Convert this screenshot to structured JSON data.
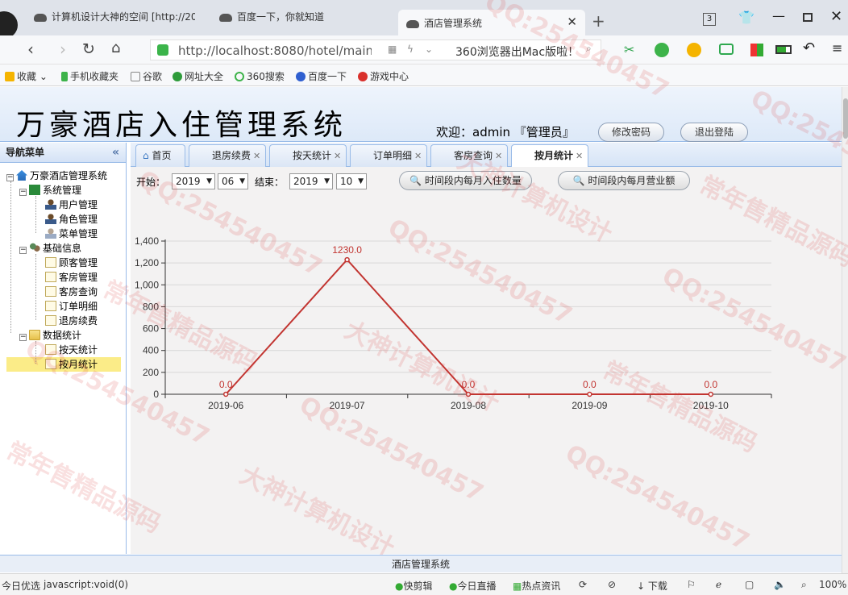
{
  "browser": {
    "tabs": [
      {
        "title": "计算机设计大神的空间 [http://20"
      },
      {
        "title": "百度一下，你就知道"
      },
      {
        "title": "酒店管理系统"
      }
    ],
    "tab_count": "3",
    "url": "http://localhost:8080/hotel/main.htm",
    "search_text": "360浏览器出Mac版啦！",
    "bookmarks": [
      "收藏",
      "手机收藏夹",
      "谷歌",
      "网址大全",
      "360搜索",
      "百度一下",
      "游戏中心"
    ],
    "status_left": "今日优选",
    "status_url": "javascript:void(0)",
    "status_items": [
      "快剪辑",
      "今日直播",
      "热点资讯",
      "下载"
    ],
    "zoom": "100%"
  },
  "app": {
    "title": "万豪酒店入住管理系统",
    "welcome": "欢迎：admin 『管理员』",
    "change_password": "修改密码",
    "logout": "退出登陆",
    "footer": "酒店管理系统"
  },
  "sidebar": {
    "header": "导航菜单",
    "root": "万豪酒店管理系统",
    "groups": [
      {
        "label": "系统管理",
        "items": [
          "用户管理",
          "角色管理",
          "菜单管理"
        ]
      },
      {
        "label": "基础信息",
        "items": [
          "顾客管理",
          "客房管理",
          "客房查询",
          "订单明细",
          "退房续费"
        ]
      },
      {
        "label": "数据统计",
        "items": [
          "按天统计",
          "按月统计"
        ]
      }
    ]
  },
  "app_tabs": [
    "首页",
    "退房续费",
    "按天统计",
    "订单明细",
    "客房查询",
    "按月统计"
  ],
  "filters": {
    "start_label": "开始：",
    "start_year": "2019",
    "start_month": "06",
    "end_label": "结束：",
    "end_year": "2019",
    "end_month": "10",
    "btn_count": "时间段内每月入住数量",
    "btn_revenue": "时间段内每月营业额"
  },
  "chart_data": {
    "type": "line",
    "categories": [
      "2019-06",
      "2019-07",
      "2019-08",
      "2019-09",
      "2019-10"
    ],
    "series": [
      {
        "values": [
          0.0,
          1230.0,
          0.0,
          0.0,
          0.0
        ]
      }
    ],
    "data_labels": [
      "0.0",
      "1230.0",
      "0.0",
      "0.0",
      "0.0"
    ],
    "yticks": [
      "0",
      "200",
      "400",
      "600",
      "800",
      "1,000",
      "1,200",
      "1,400"
    ],
    "ylim": [
      0,
      1400
    ],
    "grid": true,
    "color": "#c23531"
  },
  "watermarks": [
    "QQ:254540457",
    "常年售精品源码",
    "大神计算机设计"
  ]
}
